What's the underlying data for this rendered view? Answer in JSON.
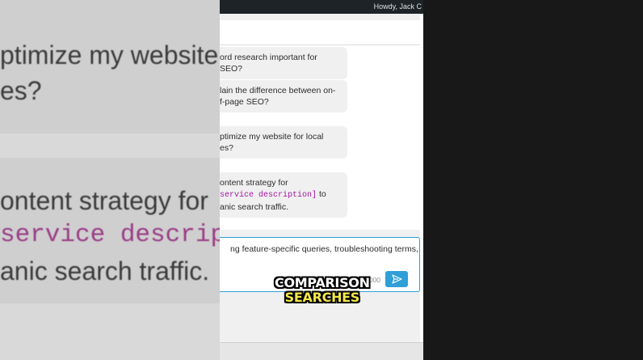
{
  "admin_bar": {
    "greeting": "Howdy, Jack C"
  },
  "chat": {
    "messages": [
      {
        "lines": [
          "ord research important for SEO?"
        ]
      },
      {
        "lines": [
          "lain the difference between on-",
          "f-page SEO?"
        ]
      },
      {
        "lines": [
          "ptimize my website for local",
          "es?"
        ]
      },
      {
        "line1": "ontent strategy for",
        "code": "service description]",
        "code_tail": " to",
        "line3": "anic search traffic."
      }
    ]
  },
  "input": {
    "value": "ng feature-specific queries, troubleshooting terms,",
    "char_count": "3/2000",
    "send_icon": "send-icon"
  },
  "background": {
    "line1": "ptimize my website",
    "line2": "es?",
    "line3": "ontent strategy for",
    "line4": "service descrip",
    "line5": "anic search traffic."
  },
  "caption": {
    "line1": "COMPARISON",
    "line2": "SEARCHES"
  },
  "colors": {
    "accent": "#2f9fd8",
    "code": "#a5169f",
    "caption_yellow": "#f4e84a"
  }
}
